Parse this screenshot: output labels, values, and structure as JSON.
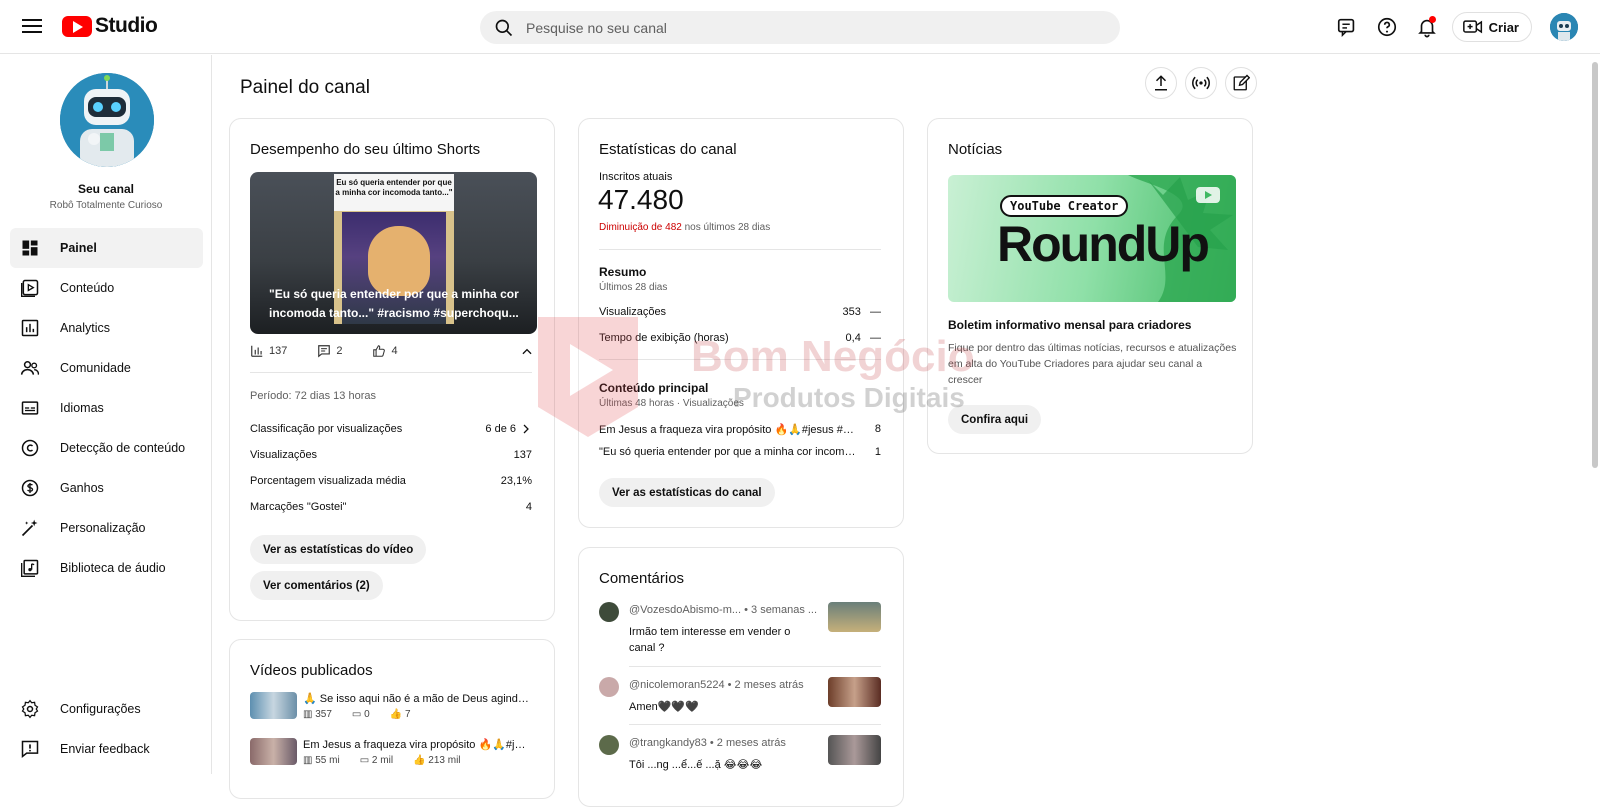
{
  "app": {
    "studio_label": "Studio"
  },
  "search": {
    "placeholder": "Pesquise no seu canal"
  },
  "topbar": {
    "create_label": "Criar"
  },
  "channel": {
    "name": "Seu canal",
    "subtitle": "Robô Totalmente Curioso"
  },
  "nav": {
    "items": [
      {
        "label": "Painel",
        "icon": "dashboard-icon",
        "active": true
      },
      {
        "label": "Conteúdo",
        "icon": "content-icon"
      },
      {
        "label": "Analytics",
        "icon": "analytics-icon"
      },
      {
        "label": "Comunidade",
        "icon": "community-icon"
      },
      {
        "label": "Idiomas",
        "icon": "subtitles-icon"
      },
      {
        "label": "Detecção de conteúdo",
        "icon": "copyright-icon"
      },
      {
        "label": "Ganhos",
        "icon": "dollar-icon"
      },
      {
        "label": "Personalização",
        "icon": "magic-wand-icon"
      },
      {
        "label": "Biblioteca de áudio",
        "icon": "audio-library-icon"
      }
    ],
    "bottom": [
      {
        "label": "Configurações",
        "icon": "gear-icon"
      },
      {
        "label": "Enviar feedback",
        "icon": "feedback-icon"
      }
    ]
  },
  "page": {
    "title": "Painel do canal"
  },
  "shorts": {
    "heading": "Desempenho do seu último Shorts",
    "thumb_caption": "Eu só queria entender por que a minha cor incomoda tanto...\"",
    "thumb_title": "\"Eu só queria entender por que a minha cor incomoda tanto...\" #racismo #superchoqu...",
    "views": "137",
    "comments": "2",
    "likes": "4",
    "period": "Período: 72 dias 13 horas",
    "rows": [
      {
        "label": "Classificação por visualizações",
        "value": "6 de 6"
      },
      {
        "label": "Visualizações",
        "value": "137"
      },
      {
        "label": "Porcentagem visualizada média",
        "value": "23,1%"
      },
      {
        "label": "Marcações \"Gostei\"",
        "value": "4"
      }
    ],
    "btn_stats": "Ver as estatísticas do vídeo",
    "btn_comments": "Ver comentários (2)"
  },
  "published": {
    "heading": "Vídeos publicados",
    "videos": [
      {
        "title": "🙏 Se isso aqui não é a mão de Deus agindo, e...",
        "views": "357",
        "comments": "0",
        "likes": "7"
      },
      {
        "title": "Em Jesus a fraqueza vira propósito 🔥🙏#jesu...",
        "views": "55 mi",
        "comments": "2 mil",
        "likes": "213 mil"
      }
    ]
  },
  "stats": {
    "heading": "Estatísticas do canal",
    "subs_label": "Inscritos atuais",
    "subs_value": "47.480",
    "change_neg": "Diminuição de 482",
    "change_rest": "nos últimos 28 dias",
    "summary_heading": "Resumo",
    "summary_period": "Últimos 28 dias",
    "summary_rows": [
      {
        "label": "Visualizações",
        "value": "353",
        "trend": "—"
      },
      {
        "label": "Tempo de exibição (horas)",
        "value": "0,4",
        "trend": "—"
      }
    ],
    "top_heading": "Conteúdo principal",
    "top_period": "Últimas 48 horas · Visualizações",
    "top_rows": [
      {
        "label": "Em Jesus a fraqueza vira propósito 🔥🙏#jesus #deus ...",
        "value": "8"
      },
      {
        "label": "\"Eu só queria entender por que a minha cor incomoda t...",
        "value": "1"
      }
    ],
    "btn": "Ver as estatísticas do canal"
  },
  "news": {
    "heading": "Notícias",
    "banner_tag": "YouTube Creator",
    "banner_title": "RoundUp",
    "title": "Boletim informativo mensal para criadores",
    "body": "Fique por dentro das últimas notícias, recursos e atualizações em alta do YouTube Criadores para ajudar seu canal a crescer",
    "btn": "Confira aqui"
  },
  "comments": {
    "heading": "Comentários",
    "items": [
      {
        "author": "@VozesdoAbismo-m...",
        "time": "• 3 semanas ...",
        "text": "Irmão tem interesse em vender o canal ?"
      },
      {
        "author": "@nicolemoran5224",
        "time": "• 2 meses atrás",
        "text": "Amen🖤🖤🖤"
      },
      {
        "author": "@trangkandy83",
        "time": "• 2 meses atrás",
        "text": "Tôi ...ng ...ể...ế ...ặ 😂😂😂"
      }
    ]
  },
  "watermark": {
    "line1": "Bom Negócio",
    "line2": "Produtos Digitais"
  },
  "colors": {
    "accent_red": "#ff0000",
    "negative": "#cc0000",
    "news_green": "#3fb862"
  }
}
